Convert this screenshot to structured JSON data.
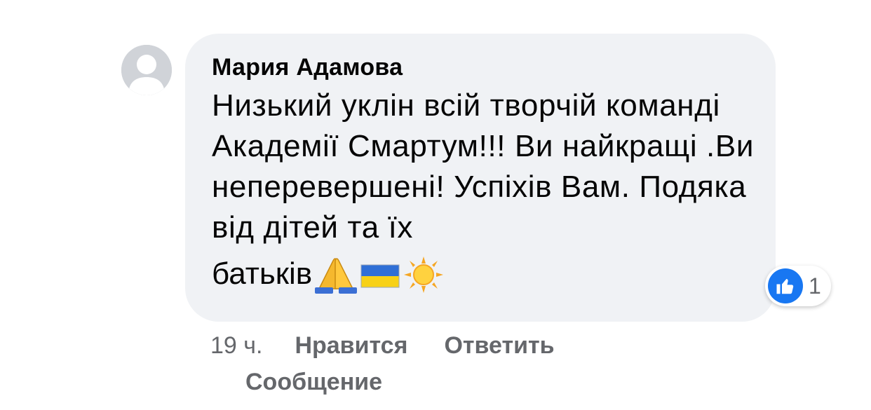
{
  "comment": {
    "author": "Мария Адамова",
    "text": "Низький уклін всій творчій команді Академії Смартум!!! Ви найкращі .Ви неперевершені! Успіхів Вам. Подяка від дітей та їх",
    "last_line_word": "батьків",
    "emojis": [
      "folded-hands-icon",
      "ukraine-flag-icon",
      "sun-icon"
    ]
  },
  "reactions": {
    "icon": "like-icon",
    "count": "1",
    "color": "#1877f2"
  },
  "meta": {
    "time": "19 ч.",
    "like_label": "Нравится",
    "reply_label": "Ответить",
    "message_label": "Сообщение"
  },
  "colors": {
    "bubble": "#f0f2f5",
    "text": "#050505",
    "secondary": "#65676b",
    "avatar": "#d0d3d8"
  }
}
